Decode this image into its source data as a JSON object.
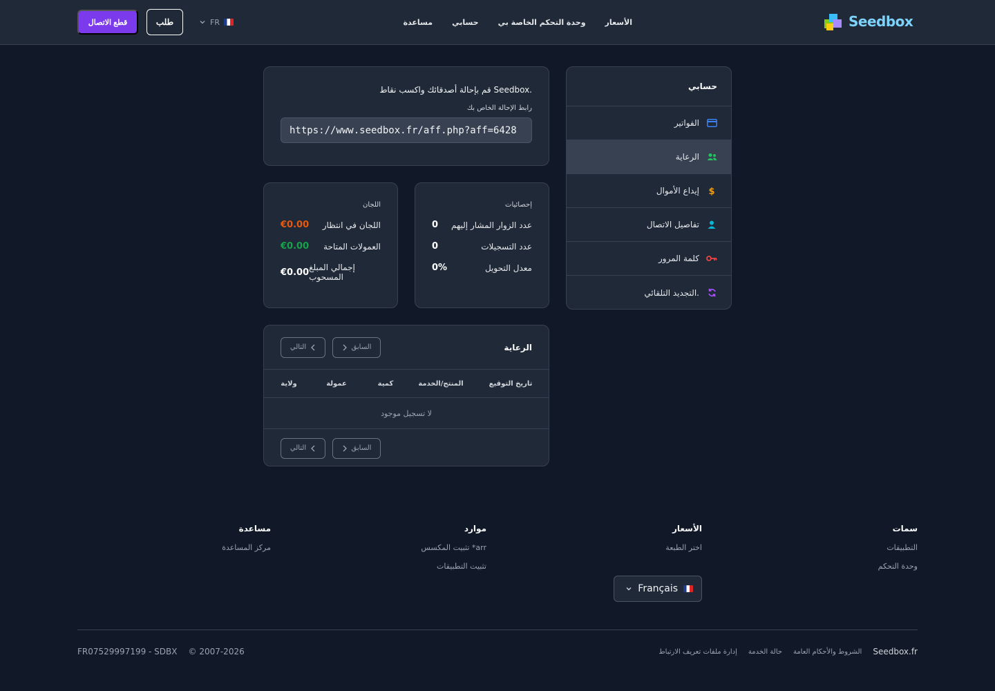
{
  "header": {
    "logo_text": "Seedbox",
    "nav": [
      "الأسعار",
      "وحدة التحكم الخاصة بي",
      "حسابي",
      "مساعدة"
    ],
    "lang_code": "FR",
    "order_label": "طلب",
    "logout_label": "قطع الاتصال"
  },
  "sidebar": {
    "title": "حسابي",
    "items": [
      {
        "label": "الفواتير",
        "icon": "credit-card-icon",
        "color": "#3b82f6"
      },
      {
        "label": "الرعاية",
        "icon": "users-icon",
        "color": "#22c55e"
      },
      {
        "label": "إيداع الأموال",
        "icon": "dollar-icon",
        "color": "#f59e0b"
      },
      {
        "label": "تفاصيل الاتصال",
        "icon": "user-icon",
        "color": "#06b6d4"
      },
      {
        "label": "كلمة المرور",
        "icon": "key-icon",
        "color": "#ef4444"
      },
      {
        "label": "التجديد التلقائي.",
        "icon": "refresh-icon",
        "color": "#a855f7"
      }
    ],
    "active_index": 1
  },
  "referral": {
    "heading": "قم بإحالة أصدقائك واكسب نقاط Seedbox.",
    "link_label": "رابط الإحالة الخاص بك",
    "link_value": "https://www.seedbox.fr/aff.php?aff=6428"
  },
  "stats": {
    "title": "إحصائيات",
    "rows": [
      {
        "label": "عدد الزوار المشار إليهم",
        "value": "0"
      },
      {
        "label": "عدد التسجيلات",
        "value": "0"
      },
      {
        "label": "معدل التحويل",
        "value": "0%"
      }
    ]
  },
  "commissions": {
    "title": "اللجان",
    "rows": [
      {
        "label": "اللجان في انتظار",
        "value": "€0.00"
      },
      {
        "label": "العمولات المتاحة",
        "value": "€0.00"
      },
      {
        "label": "إجمالي المبلغ المسحوب",
        "value": "€0.00"
      }
    ]
  },
  "sponsorship_table": {
    "title": "الرعاية",
    "prev_label": "السابق",
    "next_label": "التالي",
    "columns": [
      "تاريخ التوقيع",
      "المنتج/الخدمة",
      "كمية",
      "عمولة",
      "ولاية"
    ],
    "empty_text": "لا تسجيل موجود"
  },
  "footer": {
    "columns": [
      {
        "title": "سمات",
        "links": [
          "التطبيقات",
          "وحدة التحكم"
        ]
      },
      {
        "title": "الأسعار",
        "links": [
          "اختر الطبعة"
        ]
      },
      {
        "title": "موارد",
        "links": [
          "تثبيت المكسس *arr",
          "تثبيت التطبيقات"
        ]
      },
      {
        "title": "مساعدة",
        "links": [
          "مركز المساعدة"
        ]
      }
    ],
    "language_label": "Français",
    "brand": "Seedbox.fr",
    "legal_links": [
      "الشروط والأحكام العامة",
      "حالة الخدمة",
      "إدارة ملفات تعريف الارتباط"
    ],
    "copyright": "© 2007-2026",
    "company_id": "FR07529997199 - SDBX"
  }
}
